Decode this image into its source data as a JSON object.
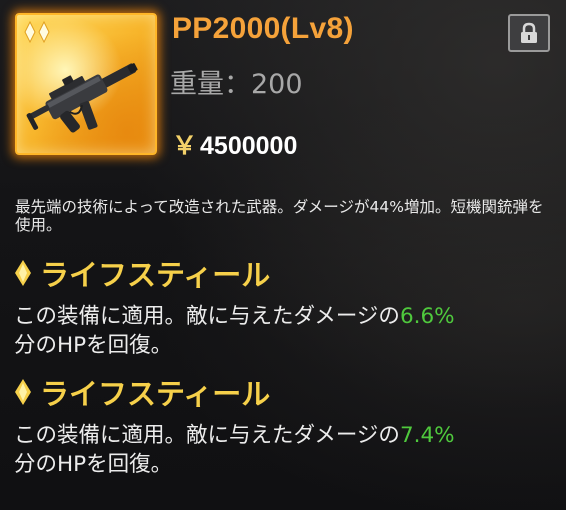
{
  "item": {
    "name": "PP2000(Lv8)",
    "weight_label": "重量",
    "weight_sep": "：",
    "weight_value": "200",
    "currency_symbol": "￥",
    "price": "4500000",
    "rarity_stars": 2,
    "icon": "smg-weapon-icon"
  },
  "lock": {
    "icon": "padlock-icon"
  },
  "description": "最先端の技術によって改造された武器。ダメージが44%増加。短機関銃弾を使用。",
  "skills": [
    {
      "title": "ライフスティール",
      "text_before": "この装備に適用。敵に与えたダメージの",
      "value": "6.6%",
      "text_after": "分のHPを回復。"
    },
    {
      "title": "ライフスティール",
      "text_before": "この装備に適用。敵に与えたダメージの",
      "value": "7.4%",
      "text_after": "分のHPを回復。"
    }
  ],
  "colors": {
    "item_name": "#f5a23a",
    "skill_title": "#f6d04a",
    "highlight_value": "#4fc93d",
    "icon_border": "#ffb628"
  }
}
